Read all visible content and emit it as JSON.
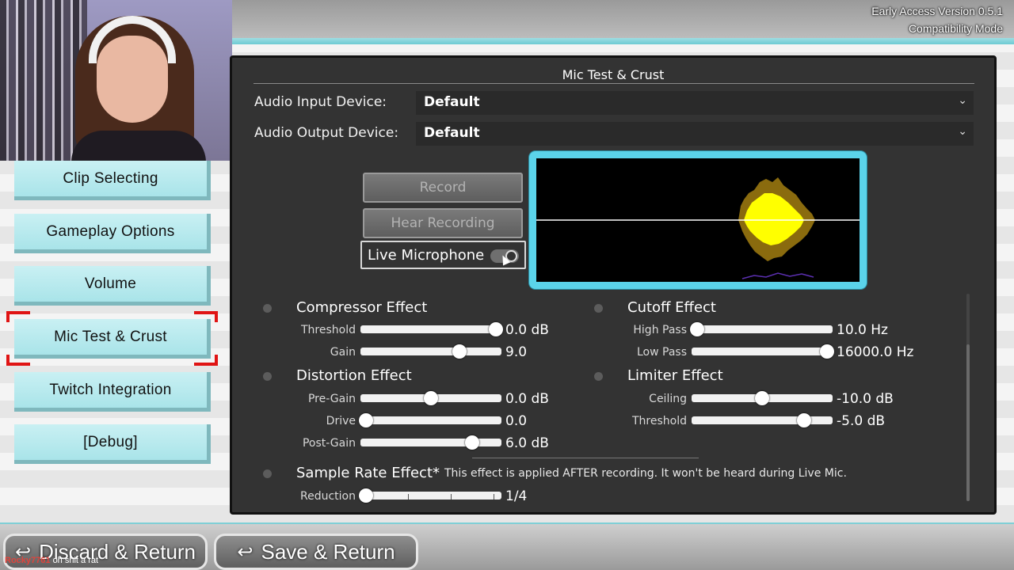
{
  "header": {
    "version_line1": "Early Access Version 0.5.1",
    "version_line2": "Compatibility Mode"
  },
  "menu": {
    "items": [
      {
        "label": "Clip Selecting"
      },
      {
        "label": "Gameplay Options"
      },
      {
        "label": "Volume"
      },
      {
        "label": "Mic Test & Crust"
      },
      {
        "label": "Twitch Integration"
      },
      {
        "label": "[Debug]"
      }
    ],
    "selected": "Mic Test & Crust"
  },
  "panel": {
    "title": "Mic Test & Crust",
    "input_device": {
      "label": "Audio Input Device:",
      "value": "Default"
    },
    "output_device": {
      "label": "Audio Output Device:",
      "value": "Default"
    },
    "record_label": "Record",
    "hear_label": "Hear Recording",
    "live_mic_label": "Live Microphone",
    "live_mic_on": true,
    "compressor": {
      "title": "Compressor Effect",
      "threshold": {
        "label": "Threshold",
        "value": "0.0 dB",
        "level": 0.96
      },
      "gain": {
        "label": "Gain",
        "value": "9.0",
        "level": 0.7
      }
    },
    "distortion": {
      "title": "Distortion Effect",
      "pregain": {
        "label": "Pre-Gain",
        "value": "0.0 dB",
        "level": 0.5
      },
      "drive": {
        "label": "Drive",
        "value": "0.0",
        "level": 0.04
      },
      "postgain": {
        "label": "Post-Gain",
        "value": "6.0 dB",
        "level": 0.79
      }
    },
    "cutoff": {
      "title": "Cutoff Effect",
      "highpass": {
        "label": "High Pass",
        "value": "10.0 Hz",
        "level": 0.04
      },
      "lowpass": {
        "label": "Low Pass",
        "value": "16000.0 Hz",
        "level": 0.96
      }
    },
    "limiter": {
      "title": "Limiter Effect",
      "ceiling": {
        "label": "Ceiling",
        "value": "-10.0 dB",
        "level": 0.5
      },
      "threshold": {
        "label": "Threshold",
        "value": "-5.0 dB",
        "level": 0.8
      }
    },
    "samplerate": {
      "title": "Sample Rate Effect*",
      "note": "This effect is applied AFTER recording. It won't be heard during Live Mic.",
      "reduction": {
        "label": "Reduction",
        "value": "1/4",
        "level": 0.04
      }
    }
  },
  "footer": {
    "discard_label": "Discard & Return",
    "save_label": "Save & Return"
  },
  "chat": {
    "user": "Rocky7761",
    "message": "oh shit a rat"
  },
  "colors": {
    "accent": "#5bd3ea",
    "menu_button": "#b5e8ec",
    "selection": "#e01414",
    "waveform": "#ffff00"
  }
}
